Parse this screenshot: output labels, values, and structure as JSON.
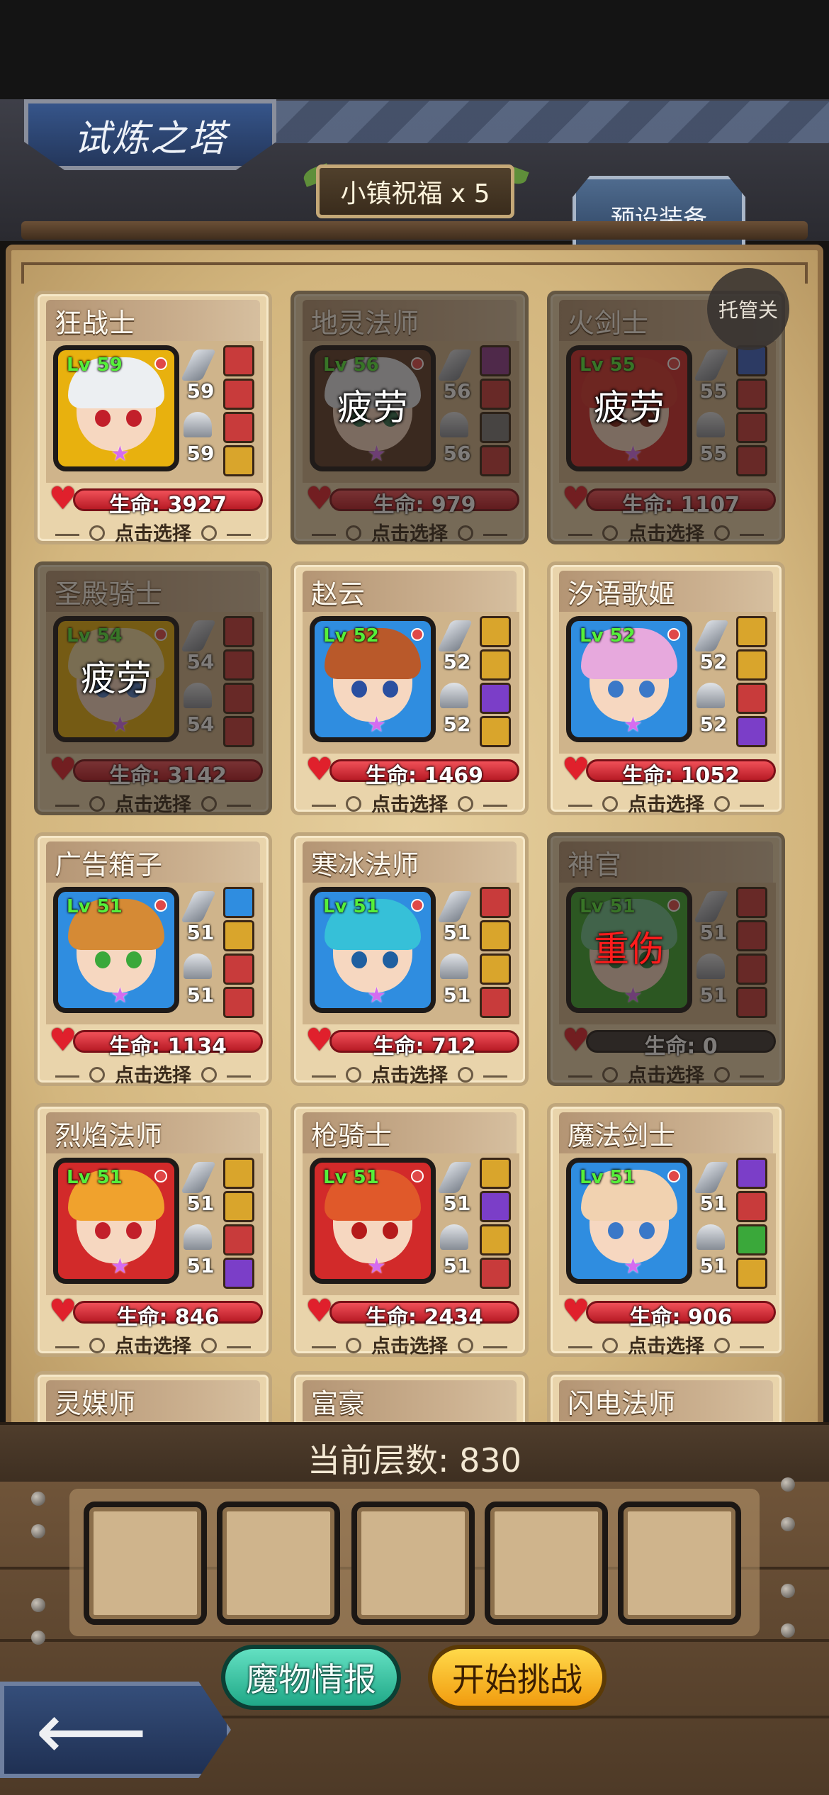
{
  "header": {
    "title": "试炼之塔",
    "blessing": "小镇祝福 x 5",
    "preset_tab": "预设装备",
    "auto_button": "托管关"
  },
  "heroes": [
    {
      "name": "狂战士",
      "level": "Lv 59",
      "weapon_lv": "59",
      "armor_lv": "59",
      "hp": "生命: 3927",
      "select": "点击选择",
      "status": "",
      "ring": "#e8b10e",
      "hair": "#eceff2",
      "eye": "#c21f2a",
      "items": [
        "#c83b3b",
        "#c83b3b",
        "#c83b3b",
        "#d9a52c"
      ]
    },
    {
      "name": "地灵法师",
      "level": "Lv 56",
      "weapon_lv": "56",
      "armor_lv": "56",
      "hp": "生命: 979",
      "select": "点击选择",
      "status": "疲劳",
      "ring": "#5c3b26",
      "hair": "#dfe3e6",
      "eye": "#2f6f4e",
      "items": [
        "#8c3a8e",
        "#c83b3b",
        "#7a7a7a",
        "#c83b3b"
      ]
    },
    {
      "name": "火剑士",
      "level": "Lv 55",
      "weapon_lv": "55",
      "armor_lv": "55",
      "hp": "生命: 1107",
      "select": "点击选择",
      "status": "疲劳",
      "ring": "#d22a2a",
      "hair": "#d3322d",
      "eye": "#7a1d12",
      "items": [
        "#3a62c8",
        "#c83b3b",
        "#c83b3b",
        "#c83b3b"
      ]
    },
    {
      "name": "圣殿骑士",
      "level": "Lv 54",
      "weapon_lv": "54",
      "armor_lv": "54",
      "hp": "生命: 3142",
      "select": "点击选择",
      "status": "疲劳",
      "ring": "#e8b10e",
      "hair": "#f1dca0",
      "eye": "#4a7ac4",
      "items": [
        "#c83b3b",
        "#c83b3b",
        "#c83b3b",
        "#c83b3b"
      ]
    },
    {
      "name": "赵云",
      "level": "Lv 52",
      "weapon_lv": "52",
      "armor_lv": "52",
      "hp": "生命: 1469",
      "select": "点击选择",
      "status": "",
      "ring": "#2f8de0",
      "hair": "#b9592a",
      "eye": "#2a4fa0",
      "items": [
        "#d9a52c",
        "#d9a52c",
        "#7b3ec8",
        "#d9a52c"
      ]
    },
    {
      "name": "汐语歌姬",
      "level": "Lv 52",
      "weapon_lv": "52",
      "armor_lv": "52",
      "hp": "生命: 1052",
      "select": "点击选择",
      "status": "",
      "ring": "#2f8de0",
      "hair": "#e7a9dd",
      "eye": "#3a78c8",
      "items": [
        "#d9a52c",
        "#d9a52c",
        "#c83b3b",
        "#7b3ec8"
      ]
    },
    {
      "name": "广告箱子",
      "level": "Lv 51",
      "weapon_lv": "51",
      "armor_lv": "51",
      "hp": "生命: 1134",
      "select": "点击选择",
      "status": "",
      "ring": "#2f8de0",
      "hair": "#d58a35",
      "eye": "#3aa83a",
      "items": [
        "#2f8de0",
        "#d9a52c",
        "#c83b3b",
        "#c83b3b"
      ]
    },
    {
      "name": "寒冰法师",
      "level": "Lv 51",
      "weapon_lv": "51",
      "armor_lv": "51",
      "hp": "生命: 712",
      "select": "点击选择",
      "status": "",
      "ring": "#2f8de0",
      "hair": "#36c0d8",
      "eye": "#1f5fa0",
      "items": [
        "#c83b3b",
        "#d9a52c",
        "#d9a52c",
        "#c83b3b"
      ]
    },
    {
      "name": "神官",
      "level": "Lv 51",
      "weapon_lv": "51",
      "armor_lv": "51",
      "hp": "生命: 0",
      "select": "点击选择",
      "status": "重伤",
      "ring": "#3aa82f",
      "hair": "#6cc38c",
      "eye": "#1f7a3a",
      "items": [
        "#c83b3b",
        "#c83b3b",
        "#c83b3b",
        "#c83b3b"
      ]
    },
    {
      "name": "烈焰法师",
      "level": "Lv 51",
      "weapon_lv": "51",
      "armor_lv": "51",
      "hp": "生命: 846",
      "select": "点击选择",
      "status": "",
      "ring": "#d22a2a",
      "hair": "#f0a22d",
      "eye": "#c21f2a",
      "items": [
        "#d9a52c",
        "#d9a52c",
        "#c83b3b",
        "#7b3ec8"
      ]
    },
    {
      "name": "枪骑士",
      "level": "Lv 51",
      "weapon_lv": "51",
      "armor_lv": "51",
      "hp": "生命: 2434",
      "select": "点击选择",
      "status": "",
      "ring": "#d22a2a",
      "hair": "#e0592a",
      "eye": "#b51a1a",
      "items": [
        "#d9a52c",
        "#7b3ec8",
        "#d9a52c",
        "#c83b3b"
      ]
    },
    {
      "name": "魔法剑士",
      "level": "Lv 51",
      "weapon_lv": "51",
      "armor_lv": "51",
      "hp": "生命: 906",
      "select": "点击选择",
      "status": "",
      "ring": "#2f8de0",
      "hair": "#f1d2b0",
      "eye": "#3a78c8",
      "items": [
        "#7b3ec8",
        "#c83b3b",
        "#3aa83a",
        "#d9a52c"
      ]
    }
  ],
  "partial_heroes": [
    "灵媒师",
    "富豪",
    "闪电法师"
  ],
  "footer": {
    "floor_label": "当前层数: 830",
    "monster_info": "魔物情报",
    "start_challenge": "开始挑战"
  }
}
